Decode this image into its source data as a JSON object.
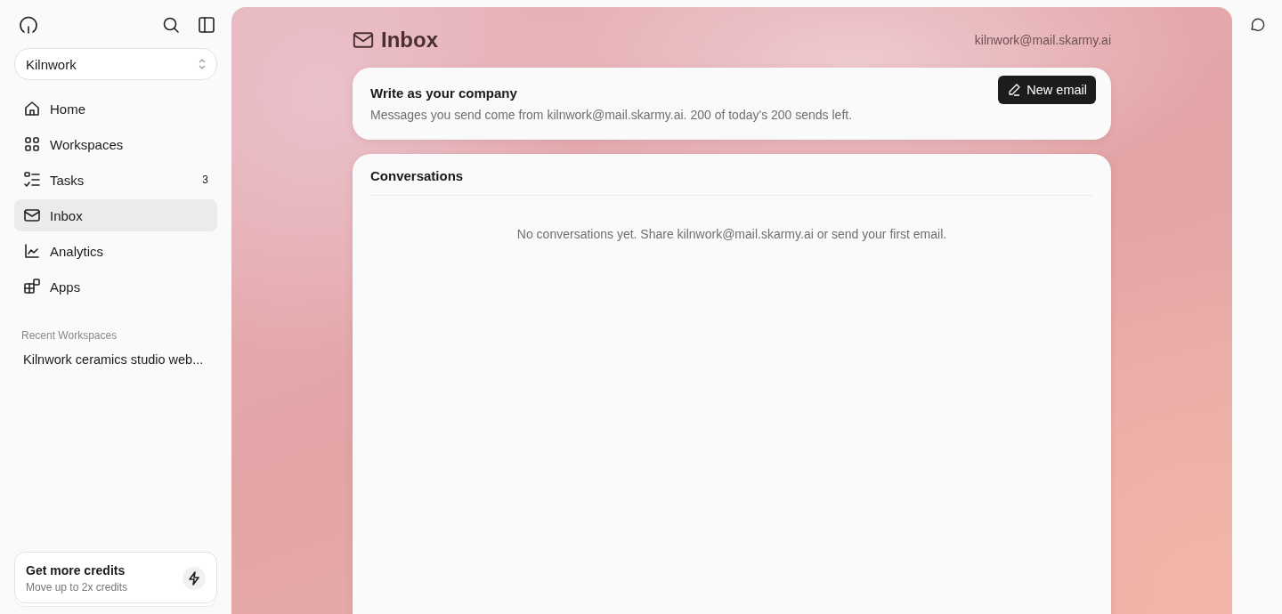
{
  "sidebar": {
    "workspace_selector": {
      "value": "Kilnwork"
    },
    "nav_items": [
      {
        "label": "Home",
        "selected": false
      },
      {
        "label": "Workspaces",
        "selected": false
      },
      {
        "label": "Tasks",
        "selected": false,
        "badge": "3"
      },
      {
        "label": "Inbox",
        "selected": true
      },
      {
        "label": "Analytics",
        "selected": false
      },
      {
        "label": "Apps",
        "selected": false
      }
    ],
    "recent_heading": "Recent Workspaces",
    "recent_items": [
      "Kilnwork ceramics studio web..."
    ],
    "credits_card": {
      "title": "Get more credits",
      "subtitle": "Move up to 2x credits"
    }
  },
  "main": {
    "title": "Inbox",
    "address": "kilnwork@mail.skarmy.ai",
    "compose_card": {
      "title": "Write as your company",
      "text": "Messages you send come from kilnwork@mail.skarmy.ai. 200 of today's 200 sends left.",
      "button": "New email"
    },
    "conversations": {
      "title": "Conversations",
      "empty_text": "No conversations yet. Share kilnwork@mail.skarmy.ai or send your first email."
    }
  }
}
